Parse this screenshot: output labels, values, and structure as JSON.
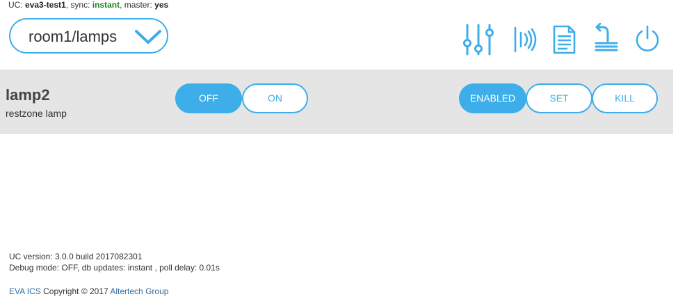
{
  "status": {
    "uc_label": "UC:",
    "uc_name": "eva3-test1",
    "sync_label": ", sync:",
    "sync_value": "instant",
    "master_label": ", master:",
    "master_value": "yes"
  },
  "group_selector": {
    "value": "room1/lamps",
    "icon": "chevron-down-icon"
  },
  "toolbar": {
    "icons": [
      "sliders-icon",
      "wireless-signal-icon",
      "document-icon",
      "undo-stack-icon",
      "power-icon"
    ]
  },
  "item": {
    "title": "lamp2",
    "description": "restzone lamp",
    "off_label": "OFF",
    "on_label": "ON",
    "state": "OFF",
    "enabled_label": "ENABLED",
    "set_label": "SET",
    "kill_label": "KILL"
  },
  "footer": {
    "version": "UC version: 3.0.0 build 2017082301",
    "debug": "Debug mode: OFF, db updates: instant , poll delay: 0.01s",
    "product_link": "EVA ICS",
    "copyright": " Copyright © 2017 ",
    "company_link": "Altertech Group"
  },
  "colors": {
    "accent": "#3daee9",
    "row_background": "#e5e5e5",
    "sync_green": "#1a8a1a",
    "link": "#2e6da4"
  }
}
